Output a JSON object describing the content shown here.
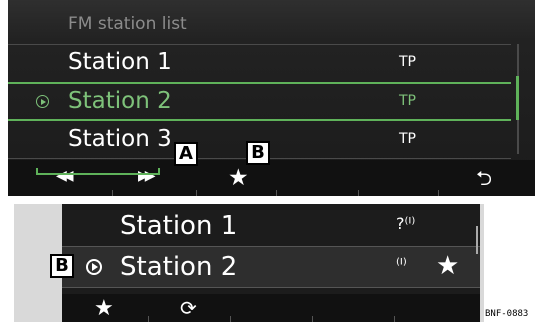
{
  "top": {
    "title": "FM station list",
    "stations": [
      {
        "name": "Station 1",
        "tp": "TP"
      },
      {
        "name": "Station 2",
        "tp": "TP"
      },
      {
        "name": "Station 3",
        "tp": "TP"
      }
    ],
    "selected_index": 1,
    "toolbar": {
      "prev_glyph": "⏪",
      "next_glyph": "⏩",
      "favorite_glyph": "★",
      "back_glyph": "⮌"
    },
    "callouts": {
      "a": "A",
      "b": "B"
    }
  },
  "bottom": {
    "stations": [
      {
        "name": "Station 1"
      },
      {
        "name": "Station 2"
      }
    ],
    "favorite_glyph": "★",
    "refresh_glyph": "⟳",
    "callout_b": "B"
  },
  "figure_code": "BNF-0883",
  "colors": {
    "accent": "#5fb25a",
    "background": "#1b1b1b"
  },
  "icons": [
    "play-icon",
    "skip-back-icon",
    "skip-forward-icon",
    "star-icon",
    "back-icon",
    "signal-icon",
    "refresh-icon"
  ]
}
